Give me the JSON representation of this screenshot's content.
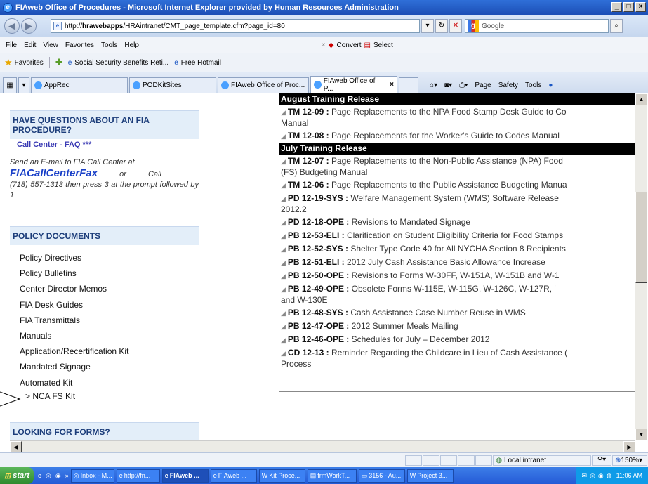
{
  "window": {
    "title": "FIAweb Office of Procedures - Microsoft Internet Explorer provided by Human Resources Administration"
  },
  "address": {
    "url_prefix": "http://",
    "url_host": "hrawebapps",
    "url_path": "/HRAintranet/CMT_page_template.cfm?page_id=80",
    "search_placeholder": "Google"
  },
  "menu": {
    "items": [
      "File",
      "Edit",
      "View",
      "Favorites",
      "Tools",
      "Help"
    ],
    "convert_label": "Convert",
    "select_label": "Select"
  },
  "favorites": {
    "label": "Favorites",
    "items": [
      "Social Security Benefits Reti...",
      "Free Hotmail"
    ]
  },
  "tabs": {
    "items": [
      "AppRec",
      "PODKitSites",
      "FIAweb Office of Proc...",
      "FIAweb Office of P..."
    ],
    "commands": [
      "Page",
      "Safety",
      "Tools"
    ]
  },
  "sidebar": {
    "questions_header": "HAVE QUESTIONS ABOUT AN FIA PROCEDURE?",
    "faq_link": "Call Center - FAQ ***",
    "callcenter_pre": "Send an E-mail to FIA Call Center at",
    "callcenter_fax": "FIACallCenterFax",
    "callcenter_or": "or",
    "callcenter_call": "Call",
    "callcenter_post": "(718) 557-1313 then press 3 at the prompt followed by 1",
    "policy_header": "POLICY DOCUMENTS",
    "links": [
      "Policy Directives",
      "Policy Bulletins",
      "Center Director Memos",
      "FIA Desk Guides",
      "FIA Transmittals",
      "Manuals",
      "Application/Recertification Kit",
      "Mandated Signage",
      "Automated Kit"
    ],
    "sublink": "> NCA FS Kit",
    "forms_header": "LOOKING FOR FORMS?"
  },
  "releases": {
    "august_header": "August Training Release",
    "august_items": [
      {
        "code": "TM 12-09 :",
        "text": "Page Replacements to the NPA Food Stamp Desk Guide to Co",
        "text2": "Manual"
      },
      {
        "code": "TM 12-08 :",
        "text": "Page Replacements for the Worker's Guide to Codes Manual",
        "text2": ""
      }
    ],
    "july_header": "July Training Release",
    "july_items": [
      {
        "code": "TM 12-07 :",
        "text": "Page Replacements to the Non-Public Assistance (NPA) Food",
        "text2": "(FS) Budgeting Manual"
      },
      {
        "code": "TM 12-06 :",
        "text": "Page Replacements to the Public Assistance Budgeting Manua",
        "text2": ""
      },
      {
        "code": "PD 12-19-SYS :",
        "text": "Welfare Management System (WMS) Software Release",
        "text2": "2012.2"
      },
      {
        "code": "PD 12-18-OPE :",
        "text": "Revisions to Mandated Signage",
        "text2": ""
      },
      {
        "code": "PB 12-53-ELI :",
        "text": "Clarification on Student Eligibility Criteria for Food Stamps",
        "text2": ""
      },
      {
        "code": "PB 12-52-SYS :",
        "text": "Shelter Type Code 40 for All NYCHA Section 8 Recipients",
        "text2": ""
      },
      {
        "code": "PB 12-51-ELI :",
        "text": "2012 July Cash Assistance Basic Allowance Increase",
        "text2": ""
      },
      {
        "code": "PB 12-50-OPE :",
        "text": "Revisions to Forms W-30FF, W-151A, W-151B and W-1",
        "text2": ""
      },
      {
        "code": "PB 12-49-OPE :",
        "text": "Obsolete Forms W-115E, W-115G, W-126C, W-127R, '",
        "text2": "and W-130E"
      },
      {
        "code": "PB 12-48-SYS :",
        "text": "Cash Assistance Case Number Reuse in WMS",
        "text2": ""
      },
      {
        "code": "PB 12-47-OPE :",
        "text": "2012 Summer Meals Mailing",
        "text2": ""
      },
      {
        "code": "PB 12-46-OPE :",
        "text": "Schedules for July – December 2012",
        "text2": ""
      },
      {
        "code": "CD 12-13 :",
        "text": "Reminder Regarding the Childcare in Lieu of Cash Assistance (",
        "text2": "Process"
      }
    ]
  },
  "status": {
    "zone": "Local intranet",
    "zoom": "150%"
  },
  "taskbar": {
    "start": "start",
    "items": [
      "Inbox - M...",
      "http://fn...",
      "FIAweb ...",
      "FIAweb ...",
      "Kit Proce...",
      "frmWorkT...",
      "3156 - Au...",
      "Project 3..."
    ],
    "clock": "11:06 AM"
  }
}
